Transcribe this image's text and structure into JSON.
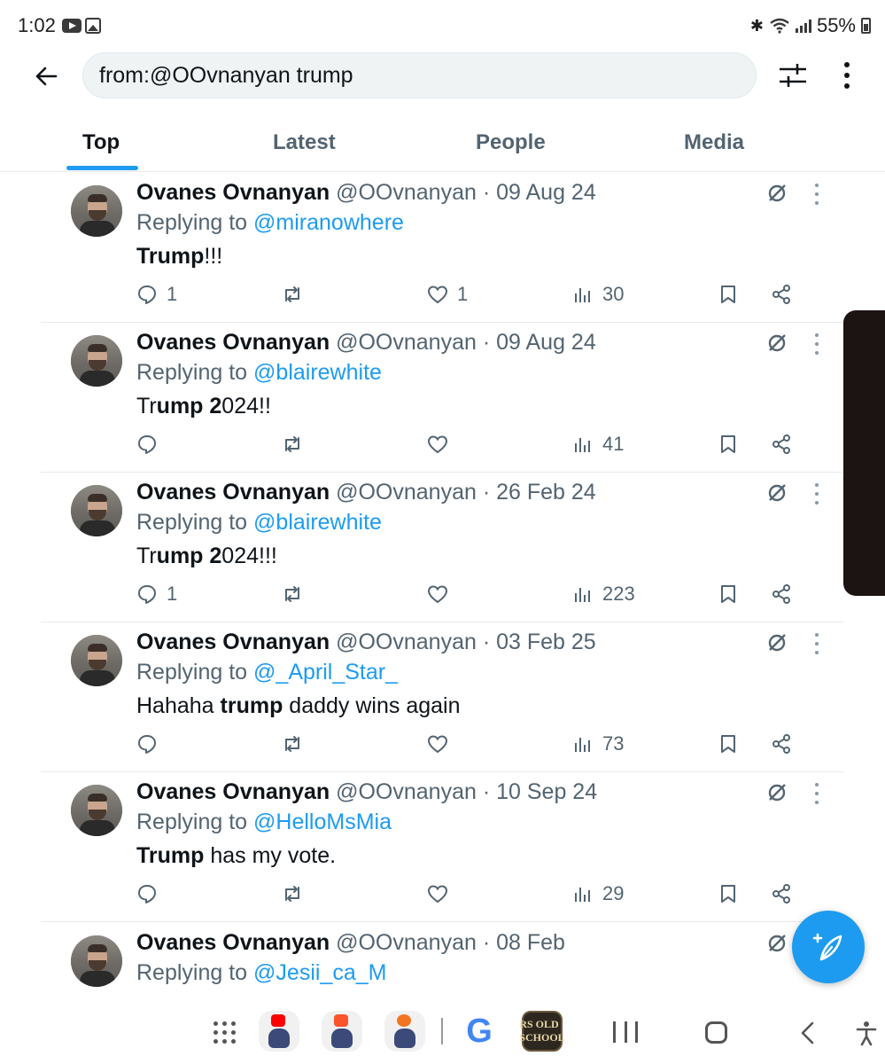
{
  "status_bar": {
    "time": "1:02",
    "battery": "55%"
  },
  "search": {
    "query": "from:@OOvnanyan trump"
  },
  "tabs": [
    {
      "label": "Top"
    },
    {
      "label": "Latest"
    },
    {
      "label": "People"
    },
    {
      "label": "Media"
    }
  ],
  "tweets": [
    {
      "name": "Ovanes Ovnanyan",
      "handle_date": "@OOvnanyan · 09 Aug 24",
      "replying_prefix": "Replying to ",
      "mention": "@miranowhere",
      "text_bold_1": "Trump",
      "text_1": "!!!",
      "replies": "1",
      "likes": "1",
      "views": "30"
    },
    {
      "name": "Ovanes Ovnanyan",
      "handle_date": "@OOvnanyan · 09 Aug 24",
      "replying_prefix": "Replying to ",
      "mention": "@blairewhite",
      "text_0": "Tr",
      "text_bold_1": "ump 2",
      "text_1": "024!!",
      "replies": "",
      "likes": "",
      "views": "41"
    },
    {
      "name": "Ovanes Ovnanyan",
      "handle_date": "@OOvnanyan · 26 Feb 24",
      "replying_prefix": "Replying to ",
      "mention": "@blairewhite",
      "text_0": "Tr",
      "text_bold_1": "ump 2",
      "text_1": "024!!!",
      "replies": "1",
      "likes": "",
      "views": "223"
    },
    {
      "name": "Ovanes Ovnanyan",
      "handle_date": "@OOvnanyan · 03 Feb 25",
      "replying_prefix": "Replying to ",
      "mention": "@_April_Star_",
      "text_0": "Hahaha ",
      "text_bold_1": "trump",
      "text_1": " daddy wins again",
      "replies": "",
      "likes": "",
      "views": "73"
    },
    {
      "name": "Ovanes Ovnanyan",
      "handle_date": "@OOvnanyan · 10 Sep 24",
      "replying_prefix": "Replying to ",
      "mention": "@HelloMsMia",
      "text_bold_1": "Trump",
      "text_1": " has my vote.",
      "replies": "",
      "likes": "",
      "views": "29"
    },
    {
      "name": "Ovanes Ovnanyan",
      "handle_date": "@OOvnanyan · 08 Feb",
      "replying_prefix": "Replying to ",
      "mention": "@Jesii_ca_M"
    }
  ],
  "icons": {
    "back": "arrow-left-icon",
    "filter": "sliders-icon",
    "more": "more-vertical-icon",
    "grok": "grok-icon",
    "reply": "reply-icon",
    "retweet": "retweet-icon",
    "like": "heart-icon",
    "views": "views-icon",
    "bookmark": "bookmark-icon",
    "share": "share-icon",
    "compose": "feather-plus-icon"
  },
  "colors": {
    "accent": "#1d9bf0",
    "text_primary": "#0f1419",
    "text_secondary": "#536471"
  },
  "nav_bar": {
    "osrs_label": "RS OLD SCHOOL"
  }
}
